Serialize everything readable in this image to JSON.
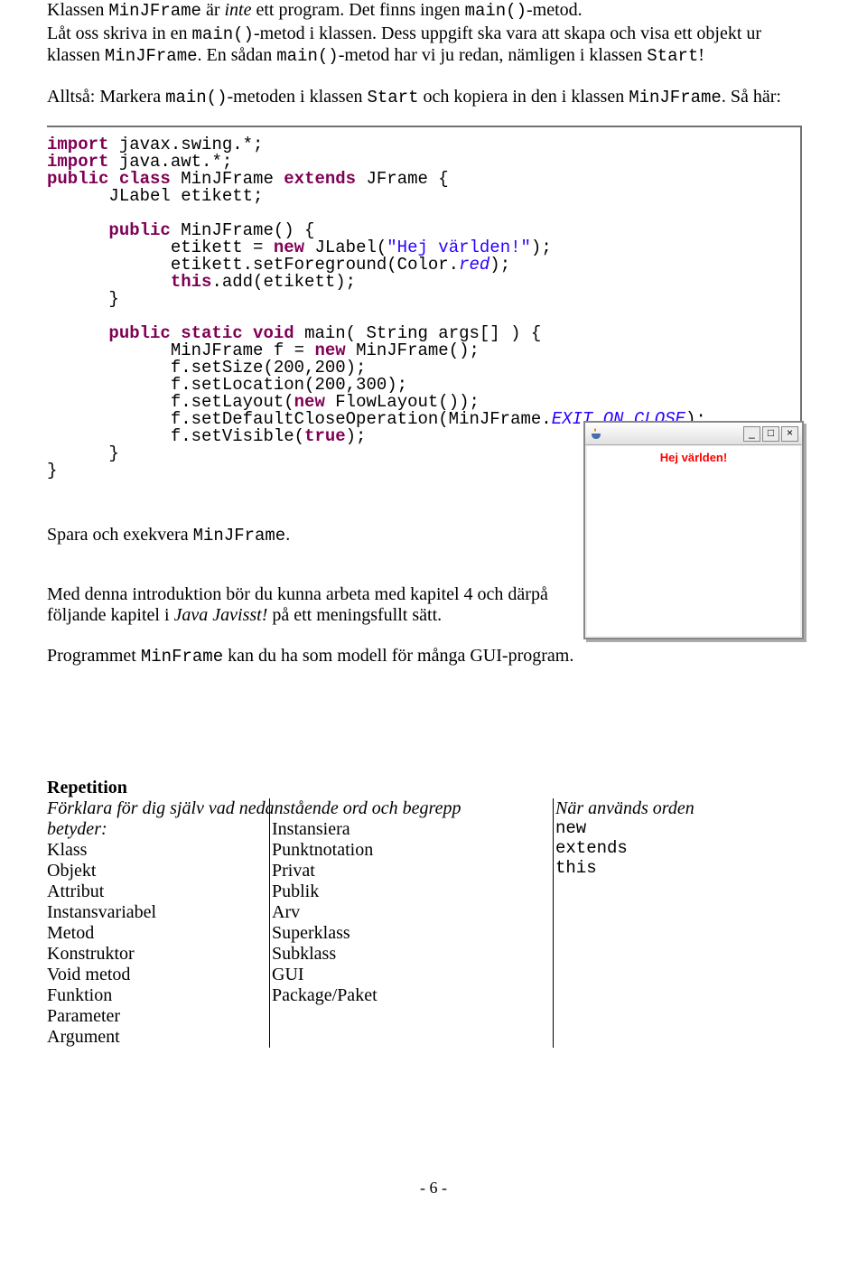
{
  "para": {
    "p1a": "Klassen ",
    "p1b": "MinJFrame",
    "p1c": " är ",
    "p1d": "inte",
    "p1e": " ett program. Det finns ingen ",
    "p1f": "main()",
    "p1g": "-metod.",
    "p2a": "Låt oss skriva in en ",
    "p2b": "main()",
    "p2c": "-metod i klassen. Dess uppgift ska vara att skapa och visa ett objekt ur klassen ",
    "p2d": "MinJFrame",
    "p2e": ". En sådan ",
    "p2f": "main()",
    "p2g": "-metod har vi ju redan, nämligen i klassen ",
    "p2h": "Start",
    "p2i": "!",
    "p3a": "Alltså:  Markera ",
    "p3b": "main()",
    "p3c": "-metoden i klassen ",
    "p3d": "Start",
    "p3e": " och kopiera in den i klassen ",
    "p3f": "MinJFrame",
    "p3g": ". Så här:",
    "p4a": "Spara och exekvera ",
    "p4b": "MinJFrame",
    "p4c": ".",
    "p5a": "Med denna introduktion bör du kunna arbeta med kapitel 4 och därpå följande kapitel i ",
    "p5b": "Java Javisst!",
    "p5c": " på ett meningsfullt sätt.",
    "p6a": "Programmet ",
    "p6b": "MinFrame",
    "p6c": " kan du ha som modell för många GUI-program."
  },
  "code": {
    "l01a": "import",
    "l01b": " javax.swing.*;",
    "l02a": "import",
    "l02b": " java.awt.*;",
    "l03a": "public",
    "l03b": " class",
    "l03c": " MinJFrame ",
    "l03d": "extends",
    "l03e": " JFrame {",
    "l04": "      JLabel etikett;",
    "l05": "",
    "l06a": "      public",
    "l06b": " MinJFrame() {",
    "l07a": "            etikett = ",
    "l07b": "new",
    "l07c": " JLabel(",
    "l07d": "\"Hej världen!\"",
    "l07e": ");",
    "l08a": "            etikett.setForeground(Color.",
    "l08b": "red",
    "l08c": ");",
    "l09a": "            this",
    "l09b": ".add(etikett);",
    "l10": "      }",
    "l11": "",
    "l12a": "      public",
    "l12b": " static",
    "l12c": " void",
    "l12d": " main( String args[] ) {",
    "l13a": "            MinJFrame f = ",
    "l13b": "new",
    "l13c": " MinJFrame();",
    "l14": "            f.setSize(200,200);",
    "l15": "            f.setLocation(200,300);",
    "l16a": "            f.setLayout(",
    "l16b": "new",
    "l16c": " FlowLayout());",
    "l17a": "            f.setDefaultCloseOperation(MinJFrame.",
    "l17b": "EXIT_ON_CLOSE",
    "l17c": ");",
    "l18a": "            f.setVisible(",
    "l18b": "true",
    "l18c": ");",
    "l19": "      }",
    "l20": "}"
  },
  "win": {
    "label": "Hej världen!",
    "min": "_",
    "max": "□",
    "close": "×"
  },
  "rep": {
    "title": "Repetition",
    "lead": "Förklara för dig själv vad nedanstående ord och begrepp betyder:",
    "right_title": "När används orden",
    "c1": [
      "Klass",
      "Objekt",
      "Attribut",
      "Instansvariabel",
      "Metod",
      "Konstruktor",
      "Void metod",
      "Funktion",
      "Parameter",
      "Argument"
    ],
    "c2": [
      "Instansiera",
      "Punktnotation",
      "Privat",
      "Publik",
      "Arv",
      "Superklass",
      "Subklass",
      "GUI",
      "Package/Paket"
    ],
    "c3": [
      "new",
      "extends",
      "this"
    ]
  },
  "pagenum": "- 6 -"
}
